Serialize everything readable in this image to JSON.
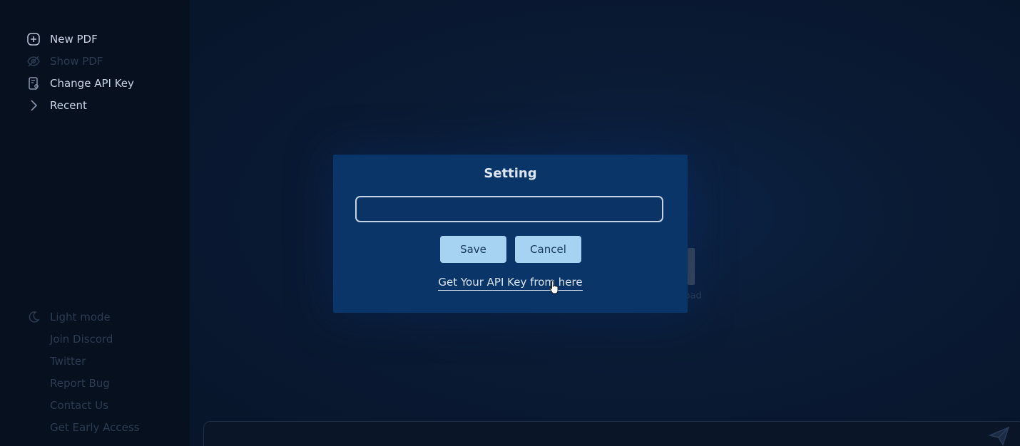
{
  "sidebar": {
    "top_items": [
      {
        "label": "New PDF",
        "icon": "plus-circle-icon"
      },
      {
        "label": "Show PDF",
        "icon": "eye-off-icon"
      },
      {
        "label": "Change API Key",
        "icon": "key-icon"
      },
      {
        "label": "Recent",
        "icon": "chevron-right-icon"
      }
    ],
    "bottom_items": [
      {
        "label": "Light mode",
        "icon": "moon-icon"
      },
      {
        "label": "Join Discord"
      },
      {
        "label": "Twitter"
      },
      {
        "label": "Report Bug"
      },
      {
        "label": "Contact Us"
      },
      {
        "label": "Get Early Access"
      }
    ]
  },
  "main": {
    "background_text": "load"
  },
  "dialog": {
    "title": "Setting",
    "api_key_value": "",
    "save_label": "Save",
    "cancel_label": "Cancel",
    "link_text": "Get Your API Key from here"
  },
  "colors": {
    "dialog_bg": "#0a3568",
    "button_bg": "#a5d3f1",
    "sidebar_bg": "#06101f",
    "main_bg": "#0a1b35"
  }
}
